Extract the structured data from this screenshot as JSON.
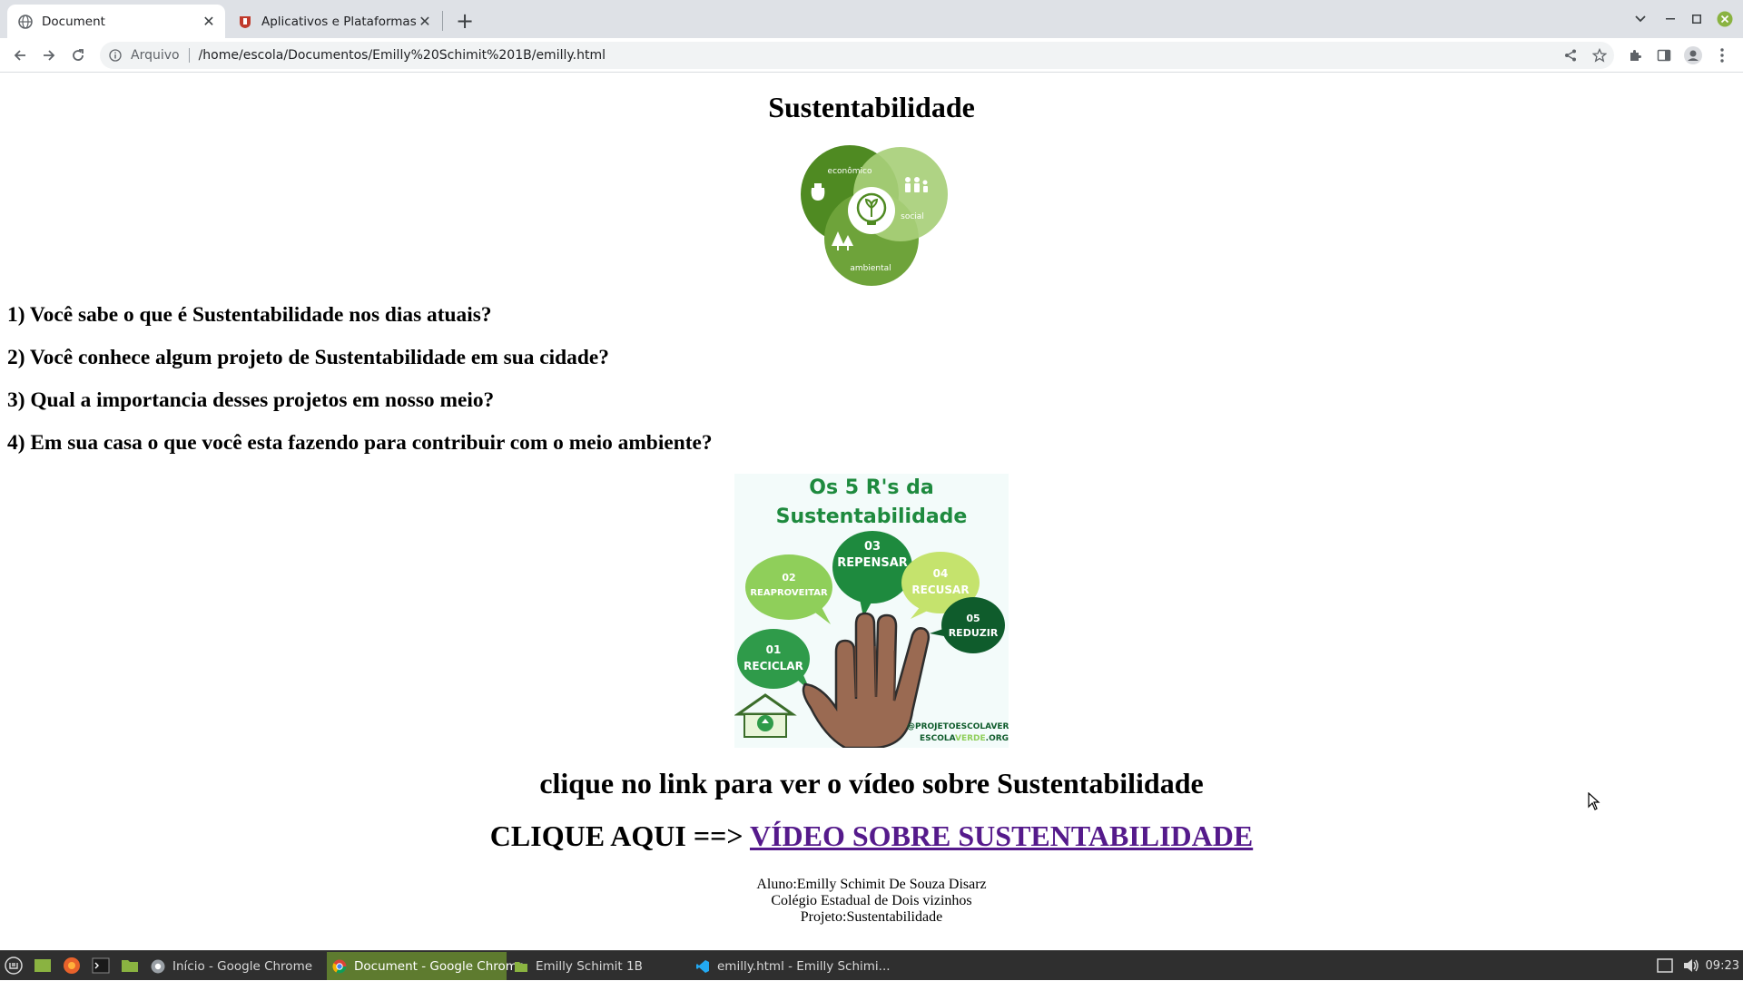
{
  "browser": {
    "tabs": [
      {
        "title": "Document",
        "active": true
      },
      {
        "title": "Aplicativos e Plataformas Edu",
        "active": false
      }
    ],
    "address": {
      "scheme_label": "Arquivo",
      "url": "/home/escola/Documentos/Emilly%20Schimit%201B/emilly.html"
    }
  },
  "page": {
    "title": "Sustentabilidade",
    "diagram1": {
      "labels": {
        "economic": "econômico",
        "social": "social",
        "environmental": "ambiental"
      }
    },
    "questions": [
      "1) Você sabe o que é Sustentabilidade nos dias atuais?",
      "2) Você conhece algum projeto de Sustentabilidade em sua cidade?",
      "3) Qual a importancia desses projetos em nosso meio?",
      "4) Em sua casa o que você esta fazendo para contribuir com o meio ambiente?"
    ],
    "poster": {
      "title_line1": "Os 5 R's da",
      "title_line2": "Sustentabilidade",
      "bubbles": [
        {
          "num": "01",
          "label": "RECICLAR"
        },
        {
          "num": "02",
          "label": "REAPROVEITAR"
        },
        {
          "num": "03",
          "label": "REPENSAR"
        },
        {
          "num": "04",
          "label": "RECUSAR"
        },
        {
          "num": "05",
          "label": "REDUZIR"
        }
      ],
      "handle": "@PROJETOESCOLAVERDE",
      "site_prefix": "ESCOLA",
      "site_highlight": "VERDE",
      "site_suffix": ".ORG"
    },
    "video_prompt": "clique no link para ver o vídeo sobre Sustentabilidade",
    "link_prefix": "CLIQUE AQUI ==> ",
    "link_text": "VÍDEO SOBRE SUSTENTABILIDADE",
    "credits": {
      "student": "Aluno:Emilly Schimit De Souza Disarz",
      "school": "Colégio Estadual de Dois vizinhos",
      "project": "Projeto:Sustentabilidade"
    }
  },
  "taskbar": {
    "tasks": [
      {
        "label": "Início - Google Chrome",
        "active": false
      },
      {
        "label": "Document - Google Chrome",
        "active": true
      },
      {
        "label": "Emilly Schimit 1B",
        "active": false
      },
      {
        "label": "emilly.html - Emilly Schimi...",
        "active": false
      }
    ],
    "clock": "09:23"
  },
  "colors": {
    "poster_dark_green": "#1e8a3e",
    "poster_light_green": "#8fcf5a",
    "link_visited": "#551a8b",
    "taskbar_active": "#5e7b2f"
  }
}
